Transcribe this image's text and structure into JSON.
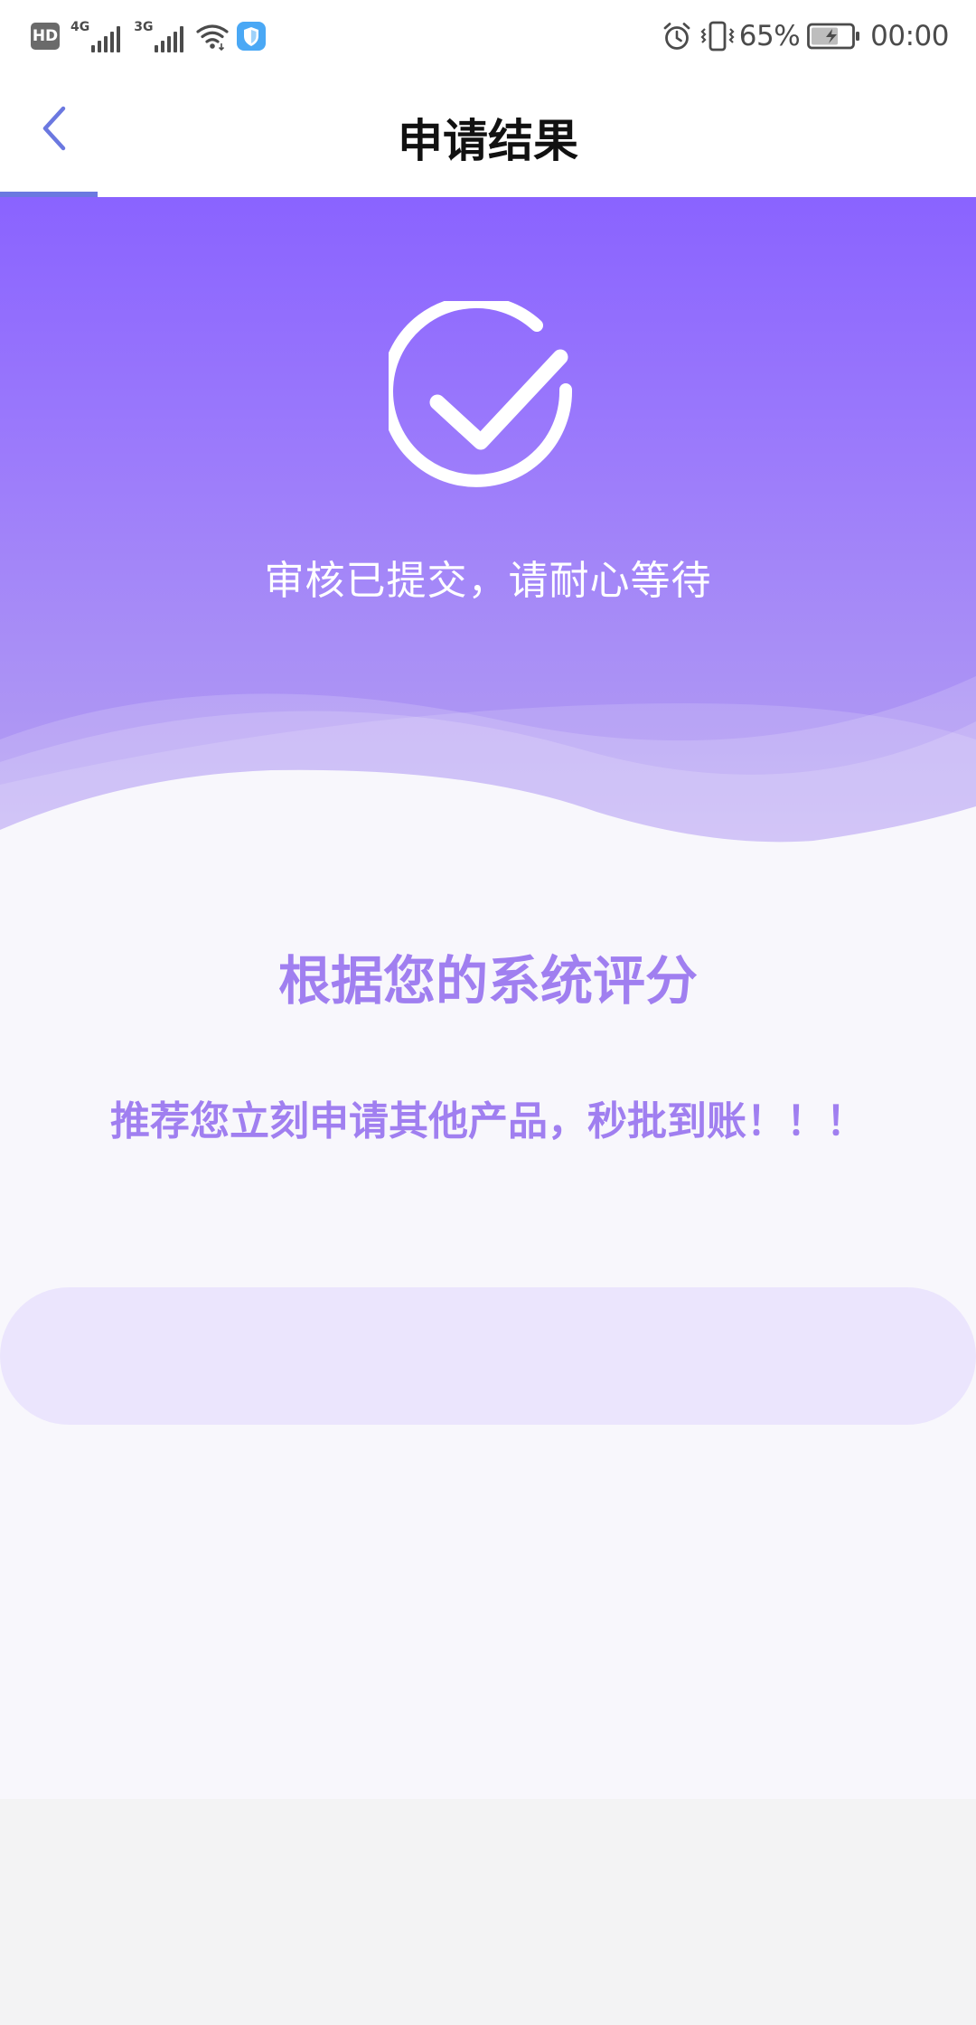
{
  "status_bar": {
    "hd_label": "HD",
    "network_1": "4G",
    "network_2": "3G",
    "battery_percent": "65%",
    "time": "00:00",
    "icons": [
      "signal-icon",
      "wifi-icon",
      "shield-app-icon",
      "alarm-icon",
      "vibrate-icon",
      "battery-charging-icon"
    ]
  },
  "nav": {
    "title": "申请结果",
    "back_icon": "chevron-left-icon",
    "accent_color": "#6b78e0"
  },
  "hero": {
    "message": "审核已提交，请耐心等待",
    "icon": "check-circle-icon",
    "gradient_top": "#8a63ff",
    "gradient_bottom": "#b6a2f3"
  },
  "content": {
    "heading": "根据您的系统评分",
    "recommendation": "推荐您立刻申请其他产品，秒批到账！！！",
    "text_color": "#a07ff0",
    "button_color": "#ebe5fd"
  }
}
